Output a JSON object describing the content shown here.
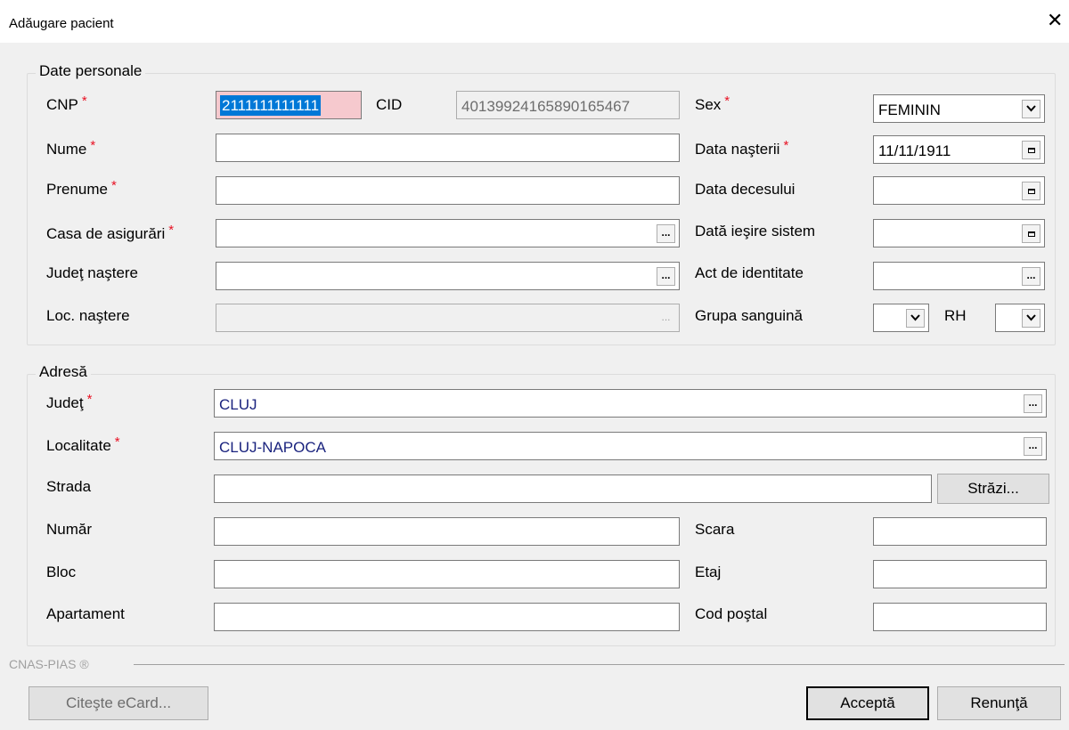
{
  "window": {
    "title": "Adăugare pacient",
    "close_glyph": "✕"
  },
  "personal": {
    "group_title": "Date personale",
    "cnp_label": "CNP",
    "cnp_value": "2111111111111",
    "cid_label": "CID",
    "cid_value": "40139924165890165467",
    "nume_label": "Nume",
    "nume_value": "",
    "prenume_label": "Prenume",
    "prenume_value": "",
    "casa_label": "Casa de asigurări",
    "casa_value": "",
    "judet_nastere_label": "Judeţ naştere",
    "judet_nastere_value": "",
    "loc_nastere_label": "Loc. naştere",
    "loc_nastere_value": "",
    "sex_label": "Sex",
    "sex_value": "FEMININ",
    "data_nasterii_label": "Data naşterii",
    "data_nasterii_value": "11/11/1911",
    "data_decesului_label": "Data decesului",
    "data_decesului_value": "",
    "data_iesire_label": "Dată ieşire sistem",
    "data_iesire_value": "",
    "act_label": "Act de identitate",
    "act_value": "",
    "grupa_label": "Grupa sanguină",
    "grupa_value": "",
    "rh_label": "RH",
    "rh_value": "",
    "required_mark": "*",
    "ellipsis": "..."
  },
  "address": {
    "group_title": "Adresă",
    "judet_label": "Judeţ",
    "judet_value": "CLUJ",
    "localitate_label": "Localitate",
    "localitate_value": "CLUJ-NAPOCA",
    "strada_label": "Strada",
    "strada_value": "",
    "strazi_button": "Străzi...",
    "numar_label": "Număr",
    "numar_value": "",
    "bloc_label": "Bloc",
    "bloc_value": "",
    "apartament_label": "Apartament",
    "apartament_value": "",
    "scara_label": "Scara",
    "scara_value": "",
    "etaj_label": "Etaj",
    "etaj_value": "",
    "cod_postal_label": "Cod poştal",
    "cod_postal_value": ""
  },
  "footer": {
    "brand": "CNAS-PIAS ®",
    "citeste_button": "Citeşte eCard...",
    "accept_button": "Acceptă",
    "cancel_button": "Renunţă"
  },
  "colors": {
    "required": "#e81123",
    "cnp_invalid_bg": "#f6c9ce",
    "selection": "#0078d7",
    "value_text": "#1a237e"
  }
}
